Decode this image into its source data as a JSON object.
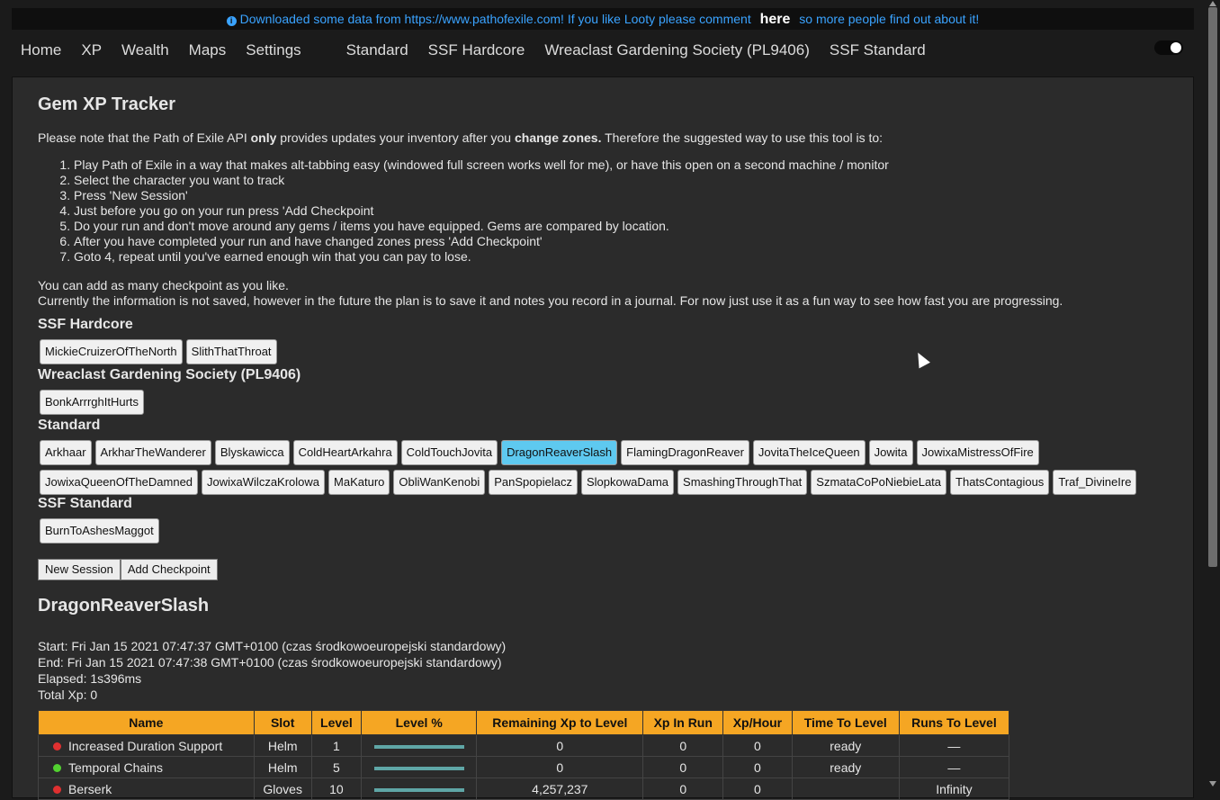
{
  "banner": {
    "text_before": "Downloaded some data from https://www.pathofexile.com! If you like Looty please comment",
    "link": "here",
    "text_after": "so more people find out about it!"
  },
  "nav": {
    "links": [
      "Home",
      "XP",
      "Wealth",
      "Maps",
      "Settings"
    ],
    "leagues": [
      "Standard",
      "SSF Hardcore",
      "Wreaclast Gardening Society (PL9406)",
      "SSF Standard"
    ]
  },
  "page": {
    "title": "Gem XP Tracker",
    "note_1": "Please note that the Path of Exile API ",
    "note_bold_1": "only",
    "note_2": " provides updates your inventory after you ",
    "note_bold_2": "change zones.",
    "note_3": " Therefore the suggested way to use this tool is to:",
    "steps": [
      "Play Path of Exile in a way that makes alt-tabbing easy (windowed full screen works well for me), or have this open on a second machine / monitor",
      "Select the character you want to track",
      "Press 'New Session'",
      "Just before you go on your run press 'Add Checkpoint",
      "Do your run and don't move around any gems / items you have equipped. Gems are compared by location.",
      "After you have completed your run and have changed zones press 'Add Checkpoint'",
      "Goto 4, repeat until you've earned enough win that you can pay to lose."
    ],
    "more_1": "You can add as many checkpoint as you like.",
    "more_2": "Currently the information is not saved, however in the future the plan is to save it and notes you record in a journal. For now just use it as a fun way to see how fast you are progressing."
  },
  "groups": [
    {
      "title": "SSF Hardcore",
      "characters": [
        "MickieCruizerOfTheNorth",
        "SlithThatThroat"
      ]
    },
    {
      "title": "Wreaclast Gardening Society (PL9406)",
      "characters": [
        "BonkArrrghItHurts"
      ]
    },
    {
      "title": "Standard",
      "characters": [
        "Arkhaar",
        "ArkharTheWanderer",
        "Blyskawicca",
        "ColdHeartArkahra",
        "ColdTouchJovita",
        "DragonReaverSlash",
        "FlamingDragonReaver",
        "JovitaTheIceQueen",
        "Jowita",
        "JowixaMistressOfFire",
        "JowixaQueenOfTheDamned",
        "JowixaWilczaKrolowa",
        "MaKaturo",
        "ObliWanKenobi",
        "PanSpopielacz",
        "SlopkowaDama",
        "SmashingThroughThat",
        "SzmataCoPoNiebieLata",
        "ThatsContagious",
        "Traf_DivineIre"
      ]
    },
    {
      "title": "SSF Standard",
      "characters": [
        "BurnToAshesMaggot"
      ]
    }
  ],
  "selected_character": "DragonReaverSlash",
  "actions": {
    "new_session": "New Session",
    "add_checkpoint": "Add Checkpoint"
  },
  "session": {
    "title": "DragonReaverSlash",
    "start": "Start: Fri Jan 15 2021 07:47:37 GMT+0100 (czas środkowoeuropejski standardowy)",
    "end": "End: Fri Jan 15 2021 07:47:38 GMT+0100 (czas środkowoeuropejski standardowy)",
    "elapsed": "Elapsed: 1s396ms",
    "total_xp": "Total Xp: 0"
  },
  "table": {
    "headers": [
      "Name",
      "Slot",
      "Level",
      "Level %",
      "Remaining Xp to Level",
      "Xp In Run",
      "Xp/Hour",
      "Time To Level",
      "Runs To Level"
    ],
    "rows": [
      {
        "status": "#e03030",
        "name": "Increased Duration Support",
        "slot": "Helm",
        "level": "1",
        "level_pct": 1.0,
        "remaining": "0",
        "xp_run": "0",
        "xp_hour": "0",
        "time": "ready",
        "runs": "—"
      },
      {
        "status": "#52d130",
        "name": "Temporal Chains",
        "slot": "Helm",
        "level": "5",
        "level_pct": 1.0,
        "remaining": "0",
        "xp_run": "0",
        "xp_hour": "0",
        "time": "ready",
        "runs": "—"
      },
      {
        "status": "#e03030",
        "name": "Berserk",
        "slot": "Gloves",
        "level": "10",
        "level_pct": 1.0,
        "remaining": "4,257,237",
        "xp_run": "0",
        "xp_hour": "0",
        "time": "",
        "runs": "Infinity"
      }
    ]
  },
  "colors": {
    "accent": "#f5a623",
    "selected": "#5ec9f0",
    "link": "#3aa3ff"
  }
}
